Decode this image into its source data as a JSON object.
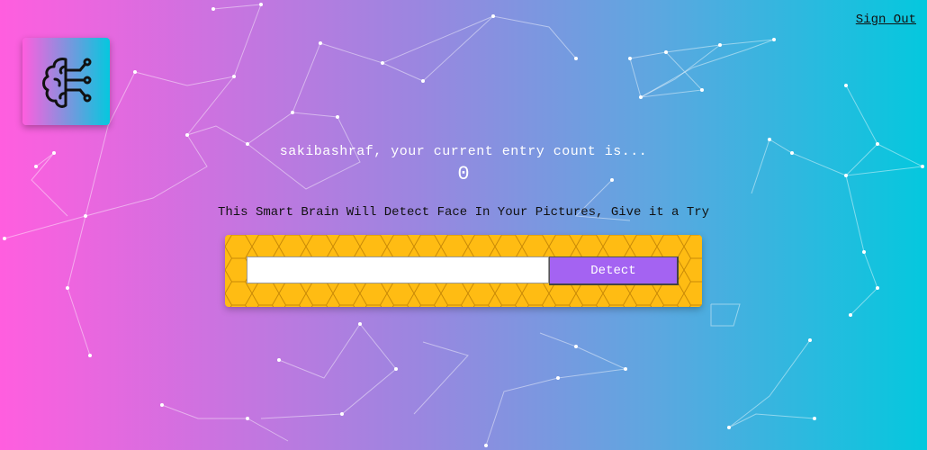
{
  "nav": {
    "sign_out_label": "Sign Out"
  },
  "logo": {
    "icon": "brain-circuit-icon"
  },
  "rank": {
    "entry_text": "sakibashraf, your current entry count is...",
    "entry_count": "0"
  },
  "image_link_form": {
    "instructions": "This Smart Brain Will Detect Face In Your Pictures, Give it a Try",
    "url_input_value": "",
    "detect_button_label": "Detect"
  },
  "colors": {
    "gradient_left": "#ff5edf",
    "gradient_right": "#04c8de",
    "panel_yellow": "#ffbc13",
    "button_purple": "#a463f2"
  }
}
